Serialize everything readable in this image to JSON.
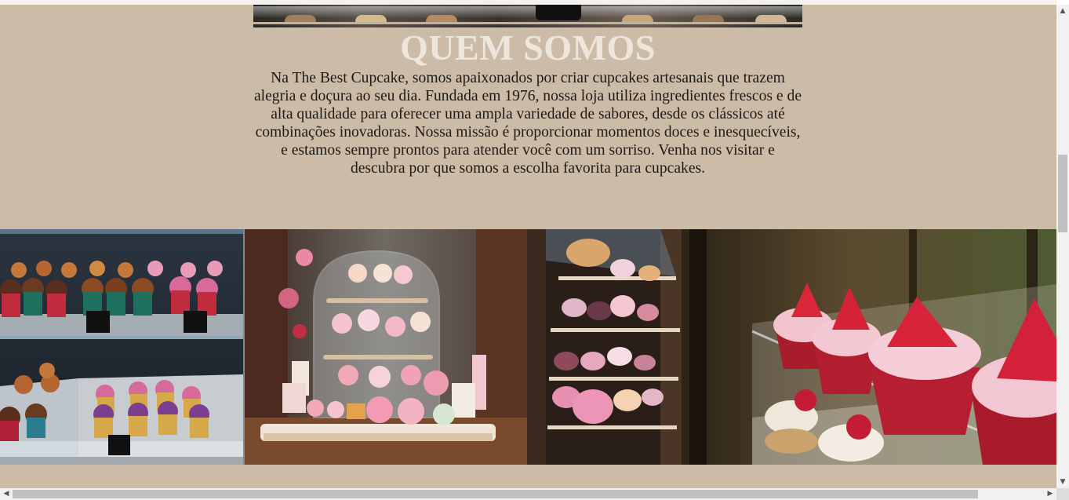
{
  "about": {
    "title": "QUEM SOMOS",
    "text": "Na The Best Cupcake, somos apaixonados por criar cupcakes artesanais que trazem alegria e doçura ao seu dia. Fundada em 1976, nossa loja utiliza ingredientes frescos e de alta qualidade para oferecer uma ampla variedade de sabores, desde os clássicos até combinações inovadoras. Nossa missão é proporcionar momentos doces e inesquecíveis, e estamos sempre prontos para atender você com um sorriso. Venha nos visitar e descubra por que somos a escolha favorita para cupcakes."
  },
  "colors": {
    "background": "#ccbba6",
    "title": "#eee6dc",
    "text": "#1e1a17"
  },
  "gallery": {
    "photos": [
      {
        "subject": "cupcakes-display-case-photo"
      },
      {
        "subject": "glass-dome-pastry-stand-photo"
      },
      {
        "subject": "tiered-pastry-shelves-photo"
      },
      {
        "subject": "strawberry-cupcakes-photo"
      }
    ]
  },
  "scrollbars": {
    "vertical": {
      "up_icon": "▲",
      "down_icon": "▼",
      "position": 0.36
    },
    "horizontal": {
      "left_icon": "◀",
      "right_icon": "▶",
      "position": 0
    }
  }
}
